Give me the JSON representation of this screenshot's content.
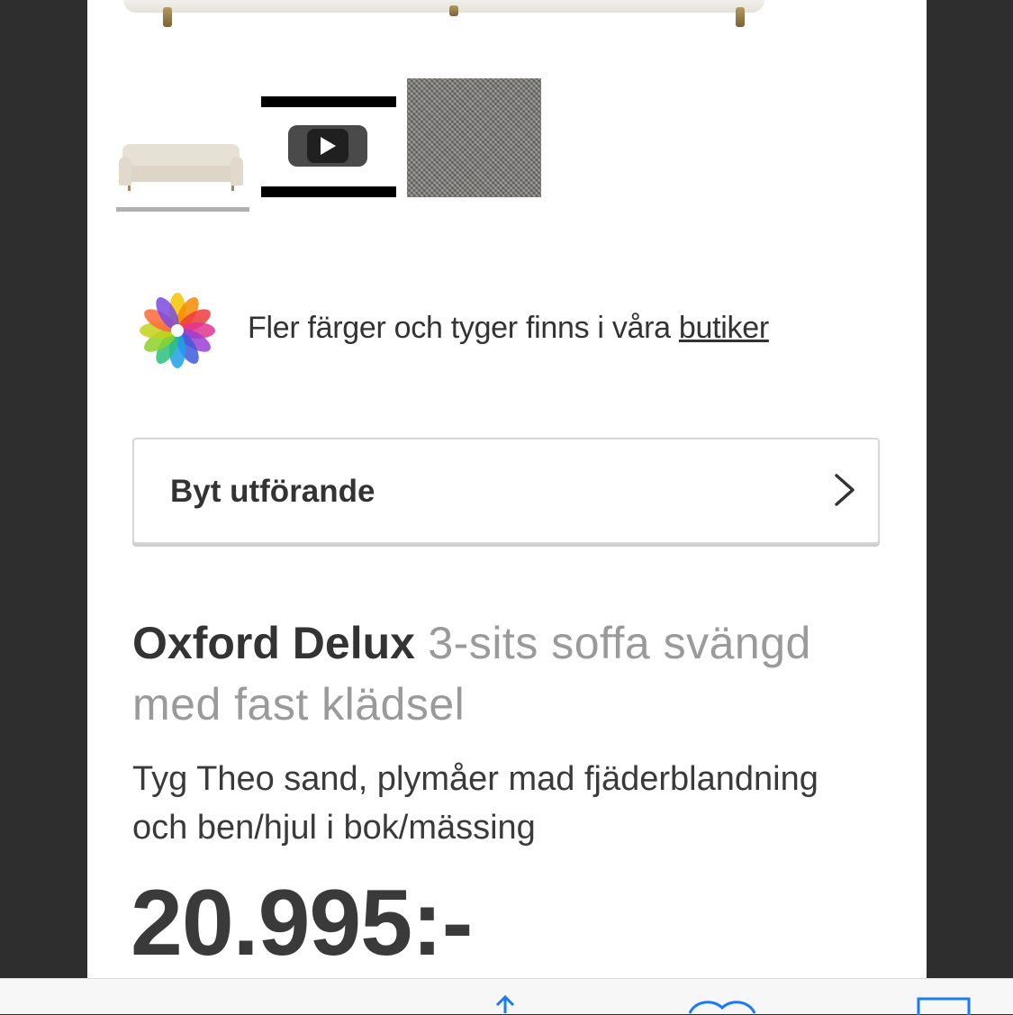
{
  "gallery": {
    "thumbnails": [
      {
        "kind": "image",
        "label": "sofa"
      },
      {
        "kind": "video",
        "label": "video"
      },
      {
        "kind": "image",
        "label": "fabric"
      }
    ],
    "selected_index": 0
  },
  "color_info": {
    "text": "Fler färger och tyger finns i våra ",
    "link": "butiker",
    "icon": "color-wheel-icon"
  },
  "variant": {
    "label": "Byt utförande",
    "icon": "chevron-right-icon"
  },
  "product": {
    "brand": "Oxford Delux",
    "name": "3-sits soffa svängd med fast klädsel",
    "description": "Tyg Theo sand, plymåer mad fjäderblandning och ben/hjul i bok/mässing",
    "price": "20.995:-"
  },
  "toolbar": {
    "icons": [
      "share-icon",
      "bookmarks-icon",
      "tabs-icon"
    ]
  },
  "colors": {
    "accent": "#1a7cf5",
    "text": "#333333",
    "muted": "#9a9a9a",
    "frame": "#2e2e2e"
  }
}
